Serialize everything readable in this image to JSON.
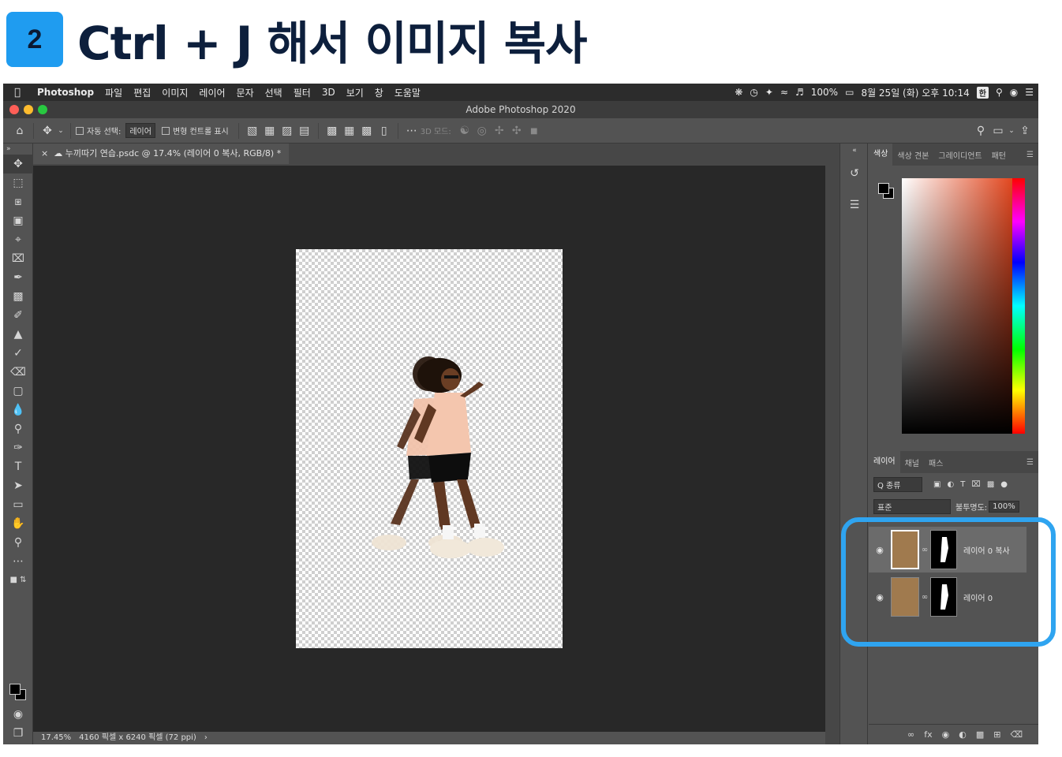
{
  "header": {
    "step_number": "2",
    "title": "Ctrl + J 해서 이미지 복사"
  },
  "menubar": {
    "apple_icon": "apple-icon",
    "app_name": "Photoshop",
    "items": [
      "파일",
      "편집",
      "이미지",
      "레이어",
      "문자",
      "선택",
      "필터",
      "3D",
      "보기",
      "창",
      "도움말"
    ],
    "battery": "100%",
    "datetime": "8월 25일 (화) 오후 10:14",
    "input_method": "한"
  },
  "window": {
    "title": "Adobe Photoshop 2020"
  },
  "options_bar": {
    "auto_select_label": "자동 선택:",
    "auto_select_value": "레이어",
    "transform_controls_label": "변형 컨트롤 표시",
    "mode_3d_label": "3D 모드:"
  },
  "document_tab": {
    "label": "누끼따기 연습.psdc @ 17.4% (레이어 0 복사, RGB/8) *"
  },
  "status": {
    "zoom": "17.45%",
    "dimensions": "4160 픽셀 x 6240 픽셀 (72 ppi)"
  },
  "color_panel": {
    "tabs": [
      "색상",
      "색상 견본",
      "그레이디언트",
      "패턴"
    ],
    "fg": "#000000",
    "bg": "#000000"
  },
  "layers_panel": {
    "tabs": [
      "레이어",
      "채널",
      "패스"
    ],
    "filter_label": "Q 종류",
    "blend_mode": "표준",
    "opacity_label": "불투명도:",
    "opacity_value": "100%",
    "layers": [
      {
        "name": "레이어 0 복사",
        "selected": true
      },
      {
        "name": "레이어 0",
        "selected": false
      }
    ]
  },
  "colors": {
    "accent": "#2fa4f0",
    "badge": "#1f9cf0"
  }
}
